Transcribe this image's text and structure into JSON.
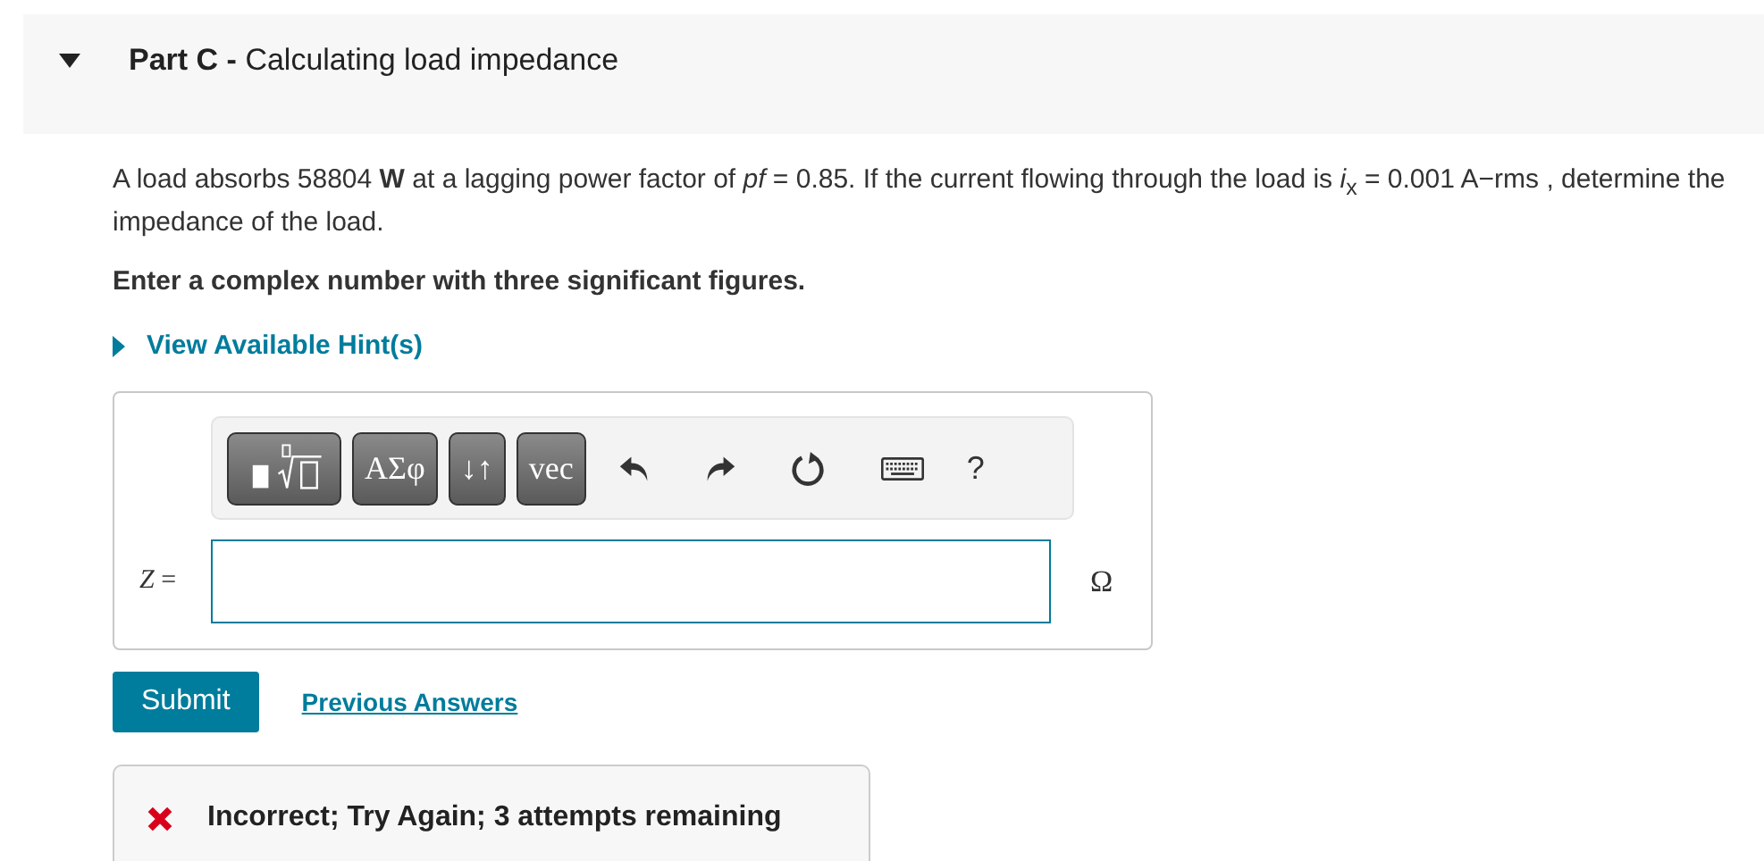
{
  "part": {
    "title": "**Part C -** Calculating load impedance",
    "expanded": true
  },
  "problem": "A load absorbs 58804 **W** at a lagging power factor of *pf* = 0.85. If the current flowing through the load is *i*$_{x}$ = 0.001 A−rms , determine the impedance of the load.",
  "instruction": "Enter a complex number with three significant figures.",
  "hint": {
    "label": "View Available Hint(s)",
    "expanded": false
  },
  "toolbar": [
    {
      "kind": "template"
    },
    {
      "kind": "text",
      "label": "ΑΣφ"
    },
    {
      "kind": "text",
      "label": "↓↑"
    },
    {
      "kind": "text",
      "label": "vec"
    },
    {
      "kind": "undo"
    },
    {
      "kind": "redo"
    },
    {
      "kind": "reset"
    },
    {
      "kind": "keyboard"
    },
    {
      "kind": "plain",
      "label": "?"
    }
  ],
  "answer": {
    "label": "*Z* =",
    "unit": "Ω"
  },
  "buttons": {
    "submit": "Submit",
    "previous": "Previous Answers"
  },
  "feedback": {
    "kind": "incorrect",
    "message": "Incorrect; Try Again; 3 attempts remaining"
  }
}
